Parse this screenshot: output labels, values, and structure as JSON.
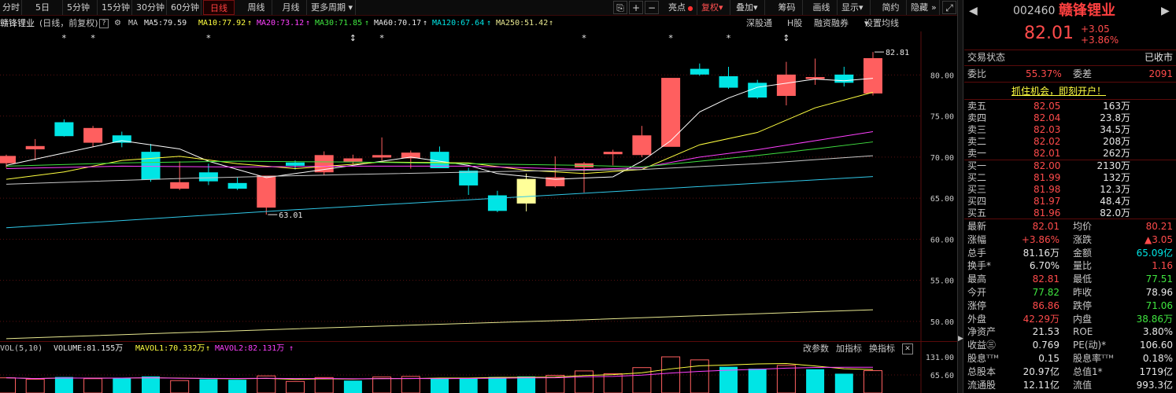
{
  "toolbar": {
    "buttons": [
      "分时",
      "5日",
      "5分钟",
      "15分钟",
      "30分钟",
      "60分钟",
      "日线",
      "周线",
      "月线",
      "更多周期"
    ],
    "right_buttons": [
      "亮点",
      "复权",
      "叠加",
      "筹码",
      "画线",
      "显示",
      "简约",
      "隐藏"
    ],
    "icons": [
      "⎘",
      "+",
      "−",
      "⤢"
    ]
  },
  "info": {
    "name": "赣锋锂业",
    "mode": "(日线，前复权)",
    "ma_prefix": "MA",
    "ma5": "MA5:79.59",
    "ma10": "MA10:77.92",
    "ma20": "MA20:73.12",
    "ma30": "MA30:71.85",
    "ma60": "MA60:70.17",
    "ma120": "MA120:67.64",
    "ma250": "MA250:51.42",
    "links": [
      "深股通",
      "H股",
      "融资融券",
      "设置均线"
    ]
  },
  "volume": {
    "label": "VOL(5,10)",
    "volume": "VOLUME:81.155万",
    "mavol1": "MAVOL1:70.332万",
    "mavol2": "MAVOL2:82.131万",
    "links": [
      "改参数",
      "加指标",
      "换指标"
    ],
    "close": "✕"
  },
  "chart_data": {
    "type": "candlestick",
    "y_ticks": [
      "80.00",
      "75.00",
      "70.00",
      "65.00",
      "60.00",
      "55.00",
      "50.00"
    ],
    "vol_ticks": [
      "131.00",
      "65.60"
    ],
    "ylim": [
      47.6,
      85.3
    ],
    "candles": [
      {
        "o": 69.3,
        "h": 70.3,
        "l": 68.7,
        "c": 70.1
      },
      {
        "o": 71.0,
        "h": 72.2,
        "l": 69.6,
        "c": 71.3
      },
      {
        "o": 74.2,
        "h": 74.6,
        "l": 72.5,
        "c": 72.6
      },
      {
        "o": 71.8,
        "h": 73.8,
        "l": 71.2,
        "c": 73.5
      },
      {
        "o": 72.6,
        "h": 73.1,
        "l": 71.2,
        "c": 71.8
      },
      {
        "o": 70.6,
        "h": 71.6,
        "l": 67.0,
        "c": 67.3
      },
      {
        "o": 66.2,
        "h": 69.5,
        "l": 66.0,
        "c": 66.9
      },
      {
        "o": 68.1,
        "h": 69.2,
        "l": 66.6,
        "c": 67.1
      },
      {
        "o": 66.8,
        "h": 67.5,
        "l": 66.0,
        "c": 66.2
      },
      {
        "o": 63.9,
        "h": 67.7,
        "l": 63.0,
        "c": 67.7
      },
      {
        "o": 69.3,
        "h": 69.6,
        "l": 68.5,
        "c": 69.0
      },
      {
        "o": 68.2,
        "h": 70.7,
        "l": 67.8,
        "c": 70.2
      },
      {
        "o": 69.5,
        "h": 70.3,
        "l": 69.1,
        "c": 69.8
      },
      {
        "o": 70.0,
        "h": 72.4,
        "l": 69.6,
        "c": 70.2
      },
      {
        "o": 69.9,
        "h": 70.8,
        "l": 68.6,
        "c": 70.5
      },
      {
        "o": 70.6,
        "h": 71.3,
        "l": 68.7,
        "c": 68.7
      },
      {
        "o": 68.3,
        "h": 68.7,
        "l": 65.4,
        "c": 66.6
      },
      {
        "o": 65.3,
        "h": 65.9,
        "l": 63.3,
        "c": 63.5
      },
      {
        "o": 64.4,
        "h": 68.0,
        "l": 63.4,
        "c": 67.3
      },
      {
        "o": 66.5,
        "h": 70.1,
        "l": 66.3,
        "c": 67.5
      },
      {
        "o": 68.8,
        "h": 69.4,
        "l": 65.7,
        "c": 69.2
      },
      {
        "o": 70.4,
        "h": 70.9,
        "l": 69.0,
        "c": 70.6
      },
      {
        "o": 70.3,
        "h": 73.8,
        "l": 70.0,
        "c": 72.6
      },
      {
        "o": 71.3,
        "h": 79.6,
        "l": 71.3,
        "c": 79.6
      },
      {
        "o": 80.7,
        "h": 81.4,
        "l": 79.9,
        "c": 80.1
      },
      {
        "o": 79.8,
        "h": 81.0,
        "l": 78.3,
        "c": 78.5
      },
      {
        "o": 79.0,
        "h": 79.4,
        "l": 77.1,
        "c": 77.3
      },
      {
        "o": 77.5,
        "h": 81.6,
        "l": 76.3,
        "c": 80.0
      },
      {
        "o": 79.7,
        "h": 82.0,
        "l": 78.8,
        "c": 79.7
      },
      {
        "o": 80.0,
        "h": 81.0,
        "l": 78.6,
        "c": 79.1
      },
      {
        "o": 77.8,
        "h": 82.8,
        "l": 77.5,
        "c": 82.0
      }
    ],
    "ma_lines": [
      {
        "name": "MA5",
        "color": "#ffffff",
        "points": [
          [
            0,
            69.0
          ],
          [
            2,
            70.5
          ],
          [
            4,
            72.0
          ],
          [
            6,
            71.0
          ],
          [
            7,
            69.5
          ],
          [
            9,
            67.5
          ],
          [
            12,
            69.0
          ],
          [
            14,
            70.0
          ],
          [
            16,
            69.0
          ],
          [
            17,
            68.0
          ],
          [
            19,
            67.3
          ],
          [
            21,
            67.6
          ],
          [
            22,
            69.5
          ],
          [
            23,
            72.0
          ],
          [
            24,
            75.5
          ],
          [
            25,
            77.2
          ],
          [
            26,
            78.5
          ],
          [
            27,
            79.0
          ],
          [
            28,
            79.5
          ],
          [
            29,
            79.3
          ],
          [
            30,
            79.6
          ]
        ]
      },
      {
        "name": "MA10",
        "color": "#ffff40",
        "points": [
          [
            0,
            67.3
          ],
          [
            2,
            68.2
          ],
          [
            4,
            69.6
          ],
          [
            6,
            70.1
          ],
          [
            8,
            69.2
          ],
          [
            10,
            68.6
          ],
          [
            13,
            69.4
          ],
          [
            16,
            69.3
          ],
          [
            18,
            68.4
          ],
          [
            20,
            68.0
          ],
          [
            22,
            68.5
          ],
          [
            24,
            71.5
          ],
          [
            26,
            73.0
          ],
          [
            28,
            76.0
          ],
          [
            30,
            77.9
          ]
        ]
      },
      {
        "name": "MA20",
        "color": "#ff40ff",
        "points": [
          [
            0,
            68.6
          ],
          [
            4,
            68.9
          ],
          [
            8,
            68.8
          ],
          [
            12,
            68.9
          ],
          [
            16,
            68.9
          ],
          [
            20,
            68.5
          ],
          [
            22,
            68.7
          ],
          [
            24,
            70.0
          ],
          [
            26,
            70.9
          ],
          [
            28,
            72.0
          ],
          [
            30,
            73.1
          ]
        ]
      },
      {
        "name": "MA30",
        "color": "#40e040",
        "points": [
          [
            0,
            68.9
          ],
          [
            4,
            69.3
          ],
          [
            8,
            69.5
          ],
          [
            12,
            69.4
          ],
          [
            16,
            69.2
          ],
          [
            20,
            69.0
          ],
          [
            22,
            68.8
          ],
          [
            24,
            69.5
          ],
          [
            26,
            70.2
          ],
          [
            28,
            71.0
          ],
          [
            30,
            71.85
          ]
        ]
      },
      {
        "name": "MA60",
        "color": "#c8c8c8",
        "points": [
          [
            0,
            66.7
          ],
          [
            6,
            67.4
          ],
          [
            12,
            67.9
          ],
          [
            18,
            68.3
          ],
          [
            22,
            68.5
          ],
          [
            26,
            69.2
          ],
          [
            30,
            70.17
          ]
        ]
      },
      {
        "name": "MA120",
        "color": "#30c8e8",
        "points": [
          [
            0,
            61.4
          ],
          [
            10,
            63.6
          ],
          [
            20,
            65.6
          ],
          [
            30,
            67.64
          ]
        ]
      },
      {
        "name": "MA250",
        "color": "#e8e890",
        "points": [
          [
            0,
            47.9
          ],
          [
            10,
            49.1
          ],
          [
            20,
            50.2
          ],
          [
            30,
            51.42
          ]
        ]
      }
    ],
    "volumes": [
      {
        "v": 55,
        "up": true
      },
      {
        "v": 50,
        "up": true
      },
      {
        "v": 58,
        "up": false
      },
      {
        "v": 52,
        "up": true
      },
      {
        "v": 55,
        "up": false
      },
      {
        "v": 60,
        "up": false
      },
      {
        "v": 45,
        "up": true
      },
      {
        "v": 50,
        "up": false
      },
      {
        "v": 48,
        "up": false
      },
      {
        "v": 62,
        "up": true
      },
      {
        "v": 42,
        "up": true
      },
      {
        "v": 56,
        "up": true
      },
      {
        "v": 45,
        "up": false
      },
      {
        "v": 58,
        "up": true
      },
      {
        "v": 60,
        "up": true
      },
      {
        "v": 52,
        "up": false
      },
      {
        "v": 55,
        "up": false
      },
      {
        "v": 58,
        "up": false
      },
      {
        "v": 60,
        "up": false
      },
      {
        "v": 64,
        "up": true
      },
      {
        "v": 80,
        "up": true
      },
      {
        "v": 70,
        "up": true
      },
      {
        "v": 92,
        "up": true
      },
      {
        "v": 131,
        "up": true
      },
      {
        "v": 120,
        "up": true
      },
      {
        "v": 95,
        "up": false
      },
      {
        "v": 88,
        "up": false
      },
      {
        "v": 100,
        "up": true
      },
      {
        "v": 86,
        "up": false
      },
      {
        "v": 70,
        "up": false
      },
      {
        "v": 81,
        "up": true
      }
    ],
    "annotations": {
      "high": "82.81",
      "low": "63.01"
    },
    "markers": [
      "*",
      "*",
      "*",
      "↕",
      "*",
      "*",
      "*",
      "*",
      "↕"
    ]
  },
  "panel": {
    "code": "002460",
    "name": "赣锋锂业",
    "price": "82.01",
    "change": "+3.05",
    "change_pct": "+3.86%",
    "trade_status_label": "交易状态",
    "trade_status": "已收市",
    "weibi_label": "委比",
    "weibi": "55.37%",
    "weicha_label": "委差",
    "weicha": "2091",
    "promo": "抓住机会，即刻开户！",
    "asks": [
      {
        "label": "卖五",
        "price": "82.05",
        "vol": "163万"
      },
      {
        "label": "卖四",
        "price": "82.04",
        "vol": "23.8万"
      },
      {
        "label": "卖三",
        "price": "82.03",
        "vol": "34.5万"
      },
      {
        "label": "卖二",
        "price": "82.02",
        "vol": "208万"
      },
      {
        "label": "卖一",
        "price": "82.01",
        "vol": "262万"
      }
    ],
    "bids": [
      {
        "label": "买一",
        "price": "82.00",
        "vol": "2130万"
      },
      {
        "label": "买二",
        "price": "81.99",
        "vol": "132万"
      },
      {
        "label": "买三",
        "price": "81.98",
        "vol": "12.3万"
      },
      {
        "label": "买四",
        "price": "81.97",
        "vol": "48.4万"
      },
      {
        "label": "买五",
        "price": "81.96",
        "vol": "82.0万"
      }
    ],
    "stats": [
      {
        "l1": "最新",
        "v1": "82.01",
        "c1": "red",
        "l2": "均价",
        "v2": "80.21",
        "c2": "red"
      },
      {
        "l1": "涨幅",
        "v1": "+3.86%",
        "c1": "red",
        "l2": "涨跌",
        "v2": "▲3.05",
        "c2": "red"
      },
      {
        "l1": "总手",
        "v1": "81.16万",
        "c1": "white",
        "l2": "金额",
        "v2": "65.09亿",
        "c2": "cyan"
      },
      {
        "l1": "换手*",
        "v1": "6.70%",
        "c1": "white",
        "l2": "量比",
        "v2": "1.16",
        "c2": "red"
      },
      {
        "l1": "最高",
        "v1": "82.81",
        "c1": "red",
        "l2": "最低",
        "v2": "77.51",
        "c2": "green"
      },
      {
        "l1": "今开",
        "v1": "77.82",
        "c1": "green",
        "l2": "昨收",
        "v2": "78.96",
        "c2": "white"
      },
      {
        "l1": "涨停",
        "v1": "86.86",
        "c1": "red",
        "l2": "跌停",
        "v2": "71.06",
        "c2": "green"
      },
      {
        "l1": "外盘",
        "v1": "42.29万",
        "c1": "red",
        "l2": "内盘",
        "v2": "38.86万",
        "c2": "green"
      },
      {
        "l1": "净资产",
        "v1": "21.53",
        "c1": "white",
        "l2": "ROE",
        "v2": "3.80%",
        "c2": "white"
      },
      {
        "l1": "收益㊂",
        "v1": "0.769",
        "c1": "white",
        "l2": "PE(动)*",
        "v2": "106.60",
        "c2": "white"
      },
      {
        "l1": "股息ᵀᵀᴹ",
        "v1": "0.15",
        "c1": "white",
        "l2": "股息率ᵀᵀᴹ",
        "v2": "0.18%",
        "c2": "white"
      },
      {
        "l1": "总股本",
        "v1": "20.97亿",
        "c1": "white",
        "l2": "总值1*",
        "v2": "1719亿",
        "c2": "white"
      },
      {
        "l1": "流通股",
        "v1": "12.11亿",
        "c1": "white",
        "l2": "流值",
        "v2": "993.3亿",
        "c2": "white"
      }
    ]
  }
}
